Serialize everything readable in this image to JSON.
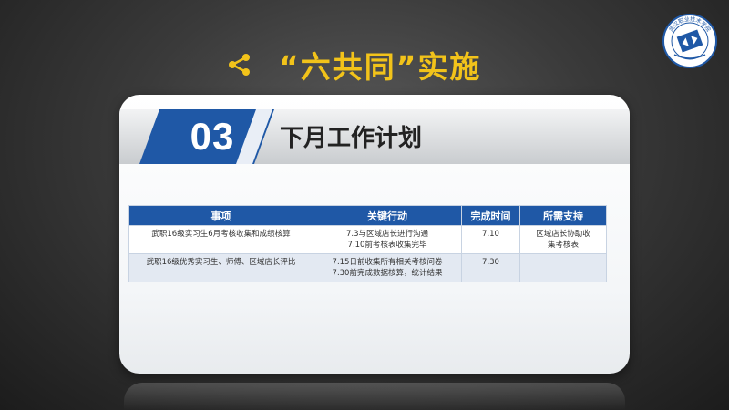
{
  "header": {
    "title": "“六共同”实施",
    "logo_label": "武汉职业技术学院"
  },
  "section": {
    "number": "03",
    "title": "下月工作计划"
  },
  "table": {
    "headers": [
      "事项",
      "关键行动",
      "完成时间",
      "所需支持"
    ],
    "rows": [
      {
        "item": "武职16级实习生6月考核收集和成绩核算",
        "action": [
          "7.3与区域店长进行沟通",
          "7.10前考核表收集完毕"
        ],
        "date": "7.10",
        "support": [
          "区域店长协助收",
          "集考核表"
        ]
      },
      {
        "item": "武职16级优秀实习生、师傅、区域店长评比",
        "action": [
          "7.15日前收集所有相关考核问卷",
          "7.30前完成数据核算，统计结果"
        ],
        "date": "7.30",
        "support": [
          "",
          ""
        ]
      }
    ]
  },
  "colors": {
    "title": "#f2c31a",
    "table_header": "#1f58a6",
    "badge": "#1f58a6"
  },
  "icons": {
    "title_icon": "share-icon",
    "logo": "school-emblem"
  }
}
